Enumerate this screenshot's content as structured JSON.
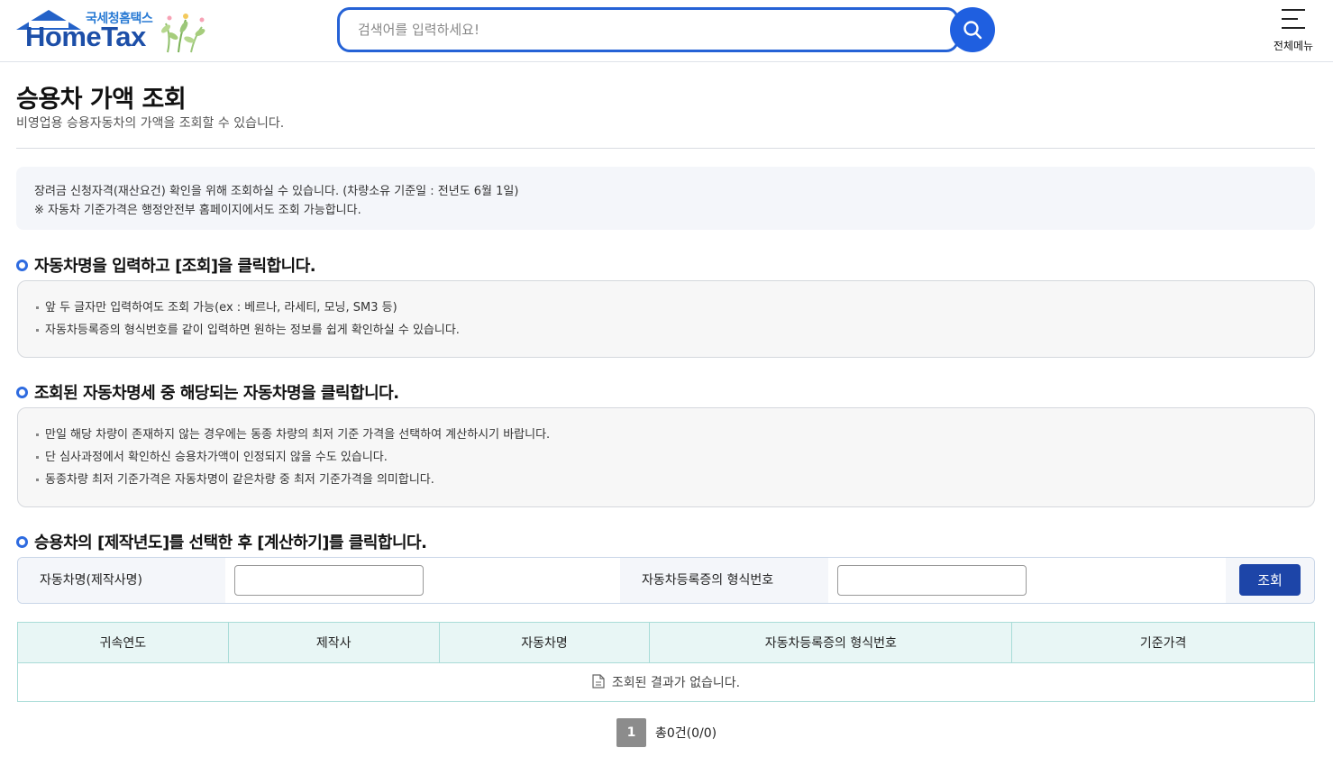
{
  "header": {
    "logo_sub": "국세청홈택스",
    "logo_main": "HomeTax",
    "search_placeholder": "검색어를 입력하세요!",
    "menu_label": "전체메뉴"
  },
  "page": {
    "title": "승용차 가액 조회",
    "subtitle": "비영업용 승용자동차의 가액을 조회할 수 있습니다."
  },
  "notice": {
    "line1": "장려금 신청자격(재산요건) 확인을 위해 조회하실 수 있습니다. (차량소유 기준일 : 전년도 6월 1일)",
    "line2": "※ 자동차 기준가격은 행정안전부 홈페이지에서도 조회 가능합니다."
  },
  "sections": [
    {
      "heading": "자동차명을 입력하고 [조회]을 클릭합니다.",
      "items": [
        "앞 두 글자만 입력하여도 조회 가능(ex : 베르나, 라세티, 모닝, SM3 등)",
        "자동차등록증의 형식번호를 같이 입력하면 원하는 정보를 쉽게 확인하실 수 있습니다."
      ]
    },
    {
      "heading": "조회된 자동차명세 중 해당되는 자동차명을 클릭합니다.",
      "items": [
        "만일 해당 차량이 존재하지 않는 경우에는 동종 차량의 최저 기준 가격을 선택하여 계산하시기 바랍니다.",
        "단 심사과정에서 확인하신 승용차가액이 인정되지 않을 수도 있습니다.",
        "동종차량 최저 기준가격은 자동차명이 같은차량 중  최저 기준가격을 의미합니다."
      ]
    },
    {
      "heading": "승용차의 [제작년도]를 선택한 후 [계산하기]를 클릭합니다."
    }
  ],
  "form": {
    "car_name_label": "자동차명(제작사명)",
    "car_name_value": "",
    "type_no_label": "자동차등록증의 형식번호",
    "type_no_value": "",
    "search_button": "조회"
  },
  "table": {
    "columns": [
      "귀속연도",
      "제작사",
      "자동차명",
      "자동차등록증의 형식번호",
      "기준가격"
    ],
    "empty_message": "조회된 결과가 없습니다."
  },
  "pagination": {
    "current_page": "1",
    "total_text": "총0건(0/0)"
  },
  "colors": {
    "primary": "#1f5fe0",
    "button": "#1d45a8",
    "table_border": "#5cc7c0",
    "table_header_bg": "#e8f6f5"
  }
}
